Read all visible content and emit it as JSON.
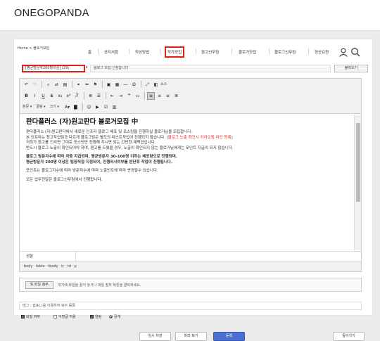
{
  "app": {
    "logo": "ONEGOPANDA"
  },
  "breadcrumb": {
    "home": "Home",
    "sep": ">",
    "current": "블로거모집"
  },
  "nav": {
    "items": [
      "홈",
      "공지사항",
      "작성방법",
      "작가모집",
      "원고신무팀",
      "블로거모집",
      "블로그신무팀",
      "정산요청"
    ]
  },
  "icons": {
    "search": "search-icon",
    "user": "user-icon"
  },
  "form": {
    "category_select": "[평균방문자200명이상] (29)",
    "title_input": "블로그 모집 신청합니다",
    "load_button": "불러오기"
  },
  "toolbar": {
    "source_label": "소스",
    "font_dropdown": "본문",
    "font_family": "굴림",
    "font_size": "크기"
  },
  "content": {
    "title": "판다플러스 (자)원고판다 블로거모집 中",
    "lines": [
      "판다플러스 (자)원고판다에서 새로운 인프라 블로그 배포 및 포스팅을 진행하실 블로거님을 모집합니다.",
      "본 인프라는 청고작업팀과 다르게 블로그팀은 별도의 테스트작업이 진행되지 않습니다.",
      "[블로그 노출 확인시 카카오톡 라인 등록]",
      "저희가 원고를 드리면 그대로 포스팅만 진행해 주시면 되는 간단한 재택업입니다.",
      "반드시 블로그 노출이 확인되어야 하며, 원고를 드렸을 경우, 노출이 확인되지 않는 블로거님에게는 포인트 지급이 되지 않습니다.",
      "블로그 방문자수에 따라 차등 지급되며, 평균방문자 30-100명 이하는 배포량으로 진행되며.",
      "평균방문자 200명 이상은 팀장직접 지정되어, 진행의사여부를 판단후 작업이 진행됩니다.",
      "포인트는 블로그지수에 따라 방문자수에 따라 노출빈도에 따라 변경될수 있습니다.",
      "모든 업무전달은 블로그신무팀에서 진행합니다."
    ],
    "table_cell": "성함"
  },
  "path": [
    "body",
    "table",
    "tbody",
    "tr",
    "td",
    "p"
  ],
  "attach": {
    "button": "파일 첨부",
    "hint": "여기에 파일을 끌어 놓거나 파일 첨부 버튼을 클릭하세요."
  },
  "tags": {
    "placeholder": "태그 : 쉼표(,)를 이용하여 복수 등록"
  },
  "options": {
    "secret": "비밀 여부",
    "anonymous": "익명글 허용",
    "notify": "알림",
    "public": "공개"
  },
  "buttons": {
    "temp_save": "임시 저장",
    "preview": "미리 보기",
    "submit": "등록",
    "back": "돌아가기"
  },
  "colors": {
    "highlight": "#e1201d",
    "primary": "#4a6fd1"
  }
}
